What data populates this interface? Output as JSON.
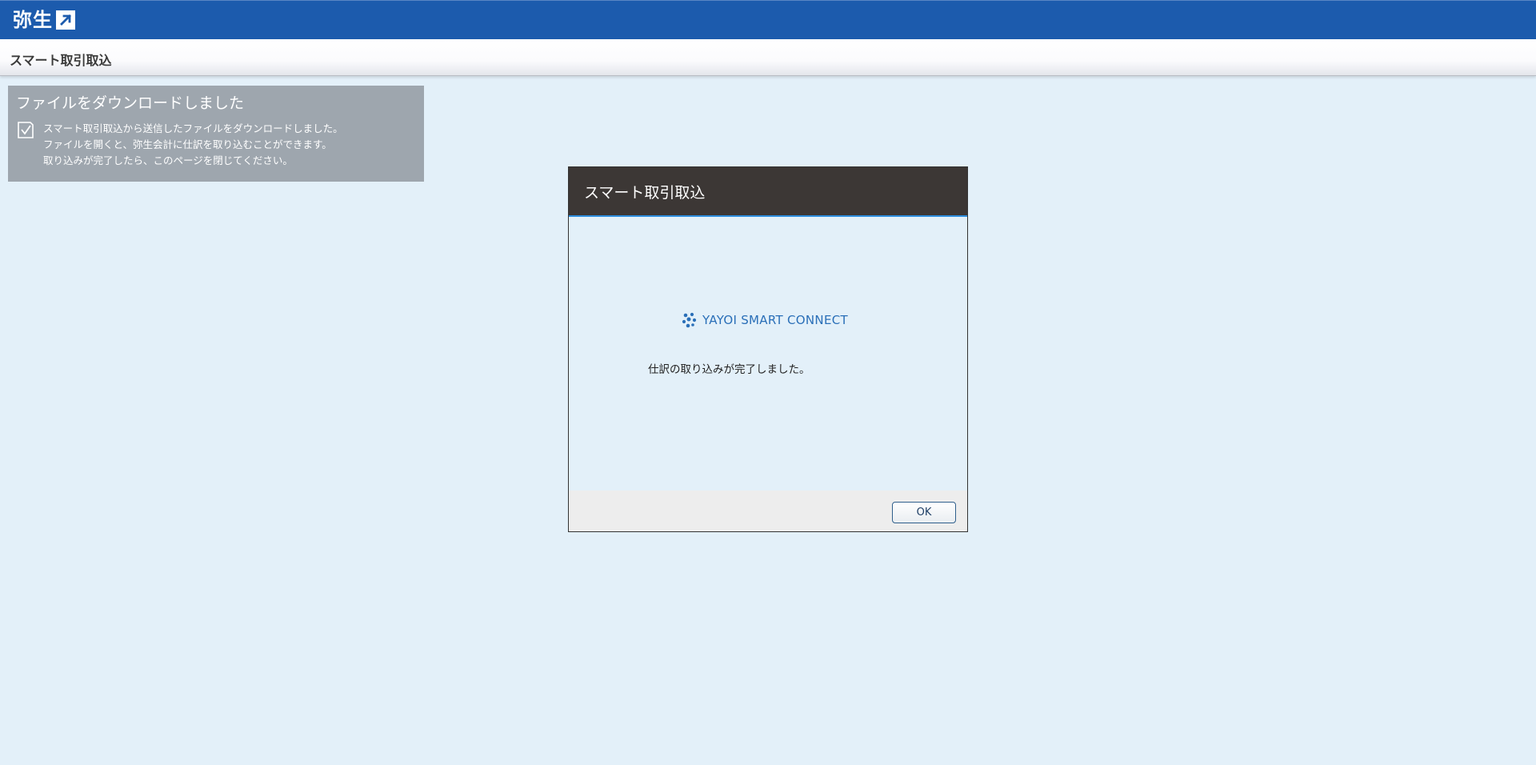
{
  "app": {
    "logo_text": "弥生",
    "logo_icon": "external-arrow-icon",
    "page_title": "スマート取引取込"
  },
  "notice": {
    "title": "ファイルをダウンロードしました",
    "icon": "checkbox-check-icon",
    "lines": [
      "スマート取引取込から送信したファイルをダウンロードしました。",
      "ファイルを開くと、弥生会計に仕訳を取り込むことができます。",
      "取り込みが完了したら、このページを閉じてください。"
    ]
  },
  "modal": {
    "title": "スマート取引取込",
    "brand_text": "YAYOI SMART CONNECT",
    "brand_icon": "yayoi-smart-connect-logo-icon",
    "message": "仕訳の取り込みが完了しました。",
    "ok_label": "OK"
  },
  "colors": {
    "topbar": "#1c5bad",
    "background": "#e3f0f9",
    "notice_bg": "#9ea6ae",
    "modal_header": "#3c3735",
    "modal_accent": "#2d8ee0",
    "brand": "#2a6fb8"
  }
}
